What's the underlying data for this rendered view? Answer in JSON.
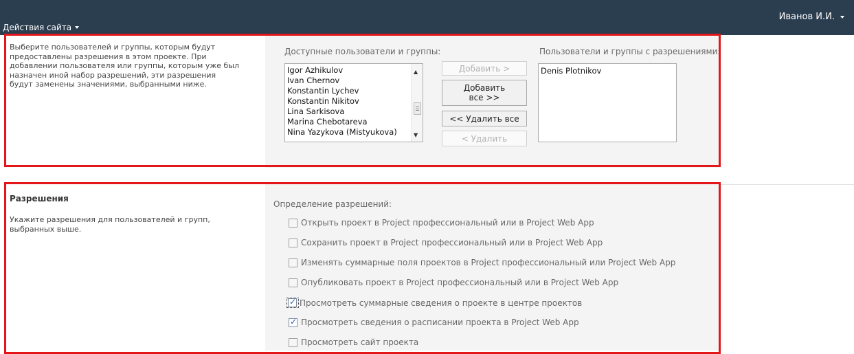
{
  "topbar": {
    "site_actions": "Действия сайта",
    "user": "Иванов И.И."
  },
  "users_section": {
    "description": "Выберите пользователей и группы, которым будут предоставлены разрешения в этом проекте. При добавлении пользователя или группы, которым уже был назначен иной набор разрешений, эти разрешения будут заменены значениями, выбранными ниже.",
    "available_label": "Доступные пользователи и группы:",
    "available_items": [
      "Igor Azhikulov",
      "Ivan Chernov",
      "Konstantin Lychev",
      "Konstantin Nikitov",
      "Lina Sarkisova",
      "Marina Chebotareva",
      "Nina Yazykova (Mistyukova)"
    ],
    "buttons": {
      "add": "Добавить >",
      "add_all": "Добавить все >>",
      "remove_all": "<< Удалить все",
      "remove": "< Удалить"
    },
    "permitted_label": "Пользователи и группы с разрешениями:",
    "permitted_items": [
      "Denis Plotnikov"
    ]
  },
  "permissions_section": {
    "heading": "Разрешения",
    "description": "Укажите разрешения для пользователей и групп, выбранных выше.",
    "definition_label": "Определение разрешений:",
    "items": [
      {
        "label": "Открыть проект в Project профессиональный или в Project Web App",
        "checked": false
      },
      {
        "label": "Сохранить проект в Project профессиональный или в Project Web App",
        "checked": false
      },
      {
        "label": "Изменять суммарные поля проектов в Project профессиональный или Project Web App",
        "checked": false
      },
      {
        "label": "Опубликовать проект в Project профессиональный или в Project Web App",
        "checked": false
      },
      {
        "label": "Просмотреть суммарные сведения о проекте в центре проектов",
        "checked": true
      },
      {
        "label": "Просмотреть сведения о расписании проекта в Project Web App",
        "checked": true
      },
      {
        "label": "Просмотреть сайт проекта",
        "checked": false
      }
    ]
  }
}
